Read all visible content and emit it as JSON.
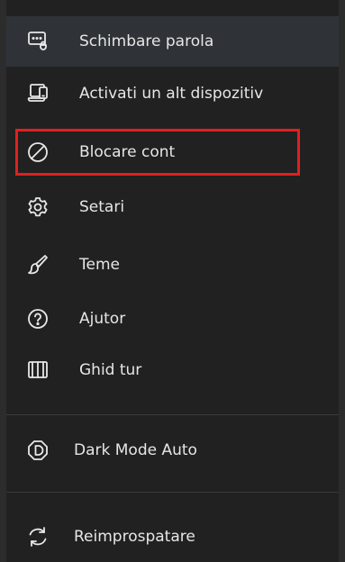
{
  "menu": {
    "items": [
      {
        "label": "Schimbare parola",
        "icon": "password-dialog-icon"
      },
      {
        "label": "Activati un alt dispozitiv",
        "icon": "devices-icon"
      },
      {
        "label": "Blocare cont",
        "icon": "block-icon"
      },
      {
        "label": "Setari",
        "icon": "gear-icon"
      },
      {
        "label": "Teme",
        "icon": "brush-icon"
      },
      {
        "label": "Ajutor",
        "icon": "help-icon"
      },
      {
        "label": "Ghid tur",
        "icon": "book-icon"
      },
      {
        "label": "Dark Mode Auto",
        "icon": "dark-mode-icon"
      },
      {
        "label": "Reimprospatare",
        "icon": "refresh-icon"
      }
    ],
    "active_item": "Schimbare parola",
    "highlighted_item": "Blocare cont"
  },
  "colors": {
    "background": "#212121",
    "active_background": "#2f3338",
    "text": "#e6e6e6",
    "highlight_border": "#e02020"
  }
}
